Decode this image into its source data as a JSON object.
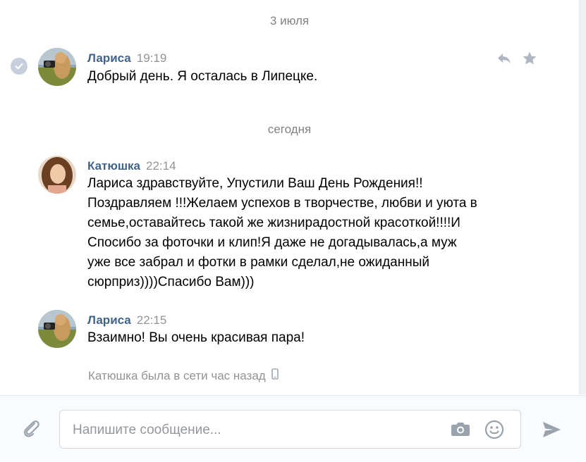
{
  "dividers": {
    "first": "3 июля",
    "second": "сегодня"
  },
  "messages": [
    {
      "author": "Лариса",
      "time": "19:19",
      "text": "Добрый день. Я осталась в Липецке.",
      "avatar_icon": "photographer-avatar",
      "read_icon": "check-circle-icon",
      "actions": [
        "reply-icon",
        "star-icon"
      ]
    },
    {
      "author": "Катюшка",
      "time": "22:14",
      "text": "Лариса здравствуйте, Упустили Ваш День Рождения!!\nПоздравляем !!!Желаем успехов в творчестве, любви и уюта в\nсемье,оставайтесь такой же жизнирадостной красоткой!!!!И\nСпосибо за фоточки и клип!Я даже не догадывалась,а муж\nуже все забрал и фотки в рамки сделал,не ожиданный\nсюрприз))))Спасибо Вам)))",
      "avatar_icon": "woman-portrait-avatar"
    },
    {
      "author": "Лариса",
      "time": "22:15",
      "text": "Взаимно! Вы очень красивая пара!",
      "avatar_icon": "photographer-avatar"
    }
  ],
  "status": {
    "text": "Катюшка была в сети час назад",
    "icon": "mobile-phone-icon"
  },
  "composer": {
    "placeholder": "Напишите сообщение...",
    "attach_icon": "paperclip-icon",
    "camera_icon": "camera-icon",
    "emoji_icon": "smiley-icon",
    "send_icon": "send-arrow-icon"
  },
  "colors": {
    "author": "#42648b",
    "meta": "#939393",
    "icon": "#828a99",
    "border": "#d3d9de"
  }
}
